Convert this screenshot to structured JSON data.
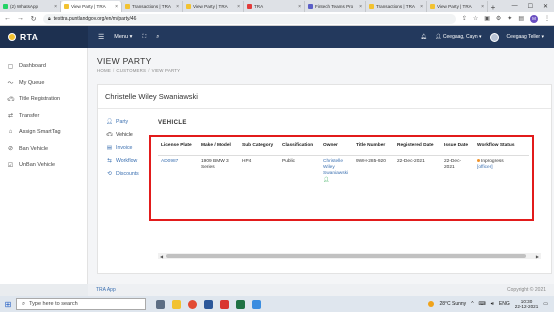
{
  "browser": {
    "tabs": [
      {
        "title": "(2) WhatsApp",
        "color": "#25d366",
        "active": false
      },
      {
        "title": "View Party | TRA",
        "color": "#f2c230",
        "active": true
      },
      {
        "title": "Transactions | TRA",
        "color": "#f2c230",
        "active": false
      },
      {
        "title": "View Party | TRA",
        "color": "#f2c230",
        "active": false
      },
      {
        "title": "TRA",
        "color": "#e23b3b",
        "active": false
      },
      {
        "title": "Fintech Teams Pro",
        "color": "#5b5fc7",
        "active": false
      },
      {
        "title": "Transactions | TRA",
        "color": "#f2c230",
        "active": false
      },
      {
        "title": "View Party | TRA",
        "color": "#f2c230",
        "active": false
      }
    ],
    "new_tab": "+",
    "url": "testtra.puntlandgov.org/en/m/party/46",
    "profile_initial": "M"
  },
  "header": {
    "brand": "RTA",
    "menu_label": "Menu",
    "user_name": "Ceegaag, Cayn",
    "role_name": "Ceegaag Teller"
  },
  "sidebar": {
    "items": [
      {
        "label": "Dashboard",
        "icon": "dashboard-icon"
      },
      {
        "label": "My Queue",
        "icon": "queue-icon"
      },
      {
        "label": "Title Registration",
        "icon": "car-icon"
      },
      {
        "label": "Transfer",
        "icon": "transfer-icon"
      },
      {
        "label": "Assign SmartTag",
        "icon": "tag-icon"
      },
      {
        "label": "Ban Vehicle",
        "icon": "ban-icon"
      },
      {
        "label": "UnBan Vehicle",
        "icon": "unban-icon"
      }
    ]
  },
  "page": {
    "title": "VIEW PARTY",
    "breadcrumb": [
      "HOME",
      "CUSTOMERS",
      "VIEW PARTY"
    ],
    "party_name": "Christelle Wiley Swaniawski",
    "tabs": [
      {
        "label": "Party",
        "icon": "person-icon"
      },
      {
        "label": "Vehicle",
        "icon": "car-icon"
      },
      {
        "label": "Invoice",
        "icon": "invoice-icon"
      },
      {
        "label": "Workflow",
        "icon": "workflow-icon"
      },
      {
        "label": "Discounts",
        "icon": "discount-icon"
      }
    ],
    "section_title": "VEHICLE"
  },
  "vehicle_table": {
    "headers": [
      "License Plate",
      "Make / Model",
      "Sub Category",
      "Classification",
      "Owner",
      "Title Number",
      "Registered Date",
      "Issue Date",
      "Workflow Status"
    ],
    "row": {
      "license_plate": "AD0987",
      "make_model": "1909 BMW 3 Series",
      "sub_category": "HP4",
      "classification": "Public",
      "owner": "Christelle Wiley Swaniawski",
      "title_number": "9WH-285-920",
      "registered_date": "22-Dec-2021",
      "issue_date": "22-Dec-2021",
      "workflow_status": "Inprogress",
      "workflow_actor": "[officer]"
    }
  },
  "footer": {
    "left": "TRA App",
    "right": "Copyright © 2021"
  },
  "taskbar": {
    "search_placeholder": "Type here to search",
    "weather": "28°C  Sunny",
    "lang": "ENG",
    "time": "10:30",
    "date": "22-12-2021"
  }
}
